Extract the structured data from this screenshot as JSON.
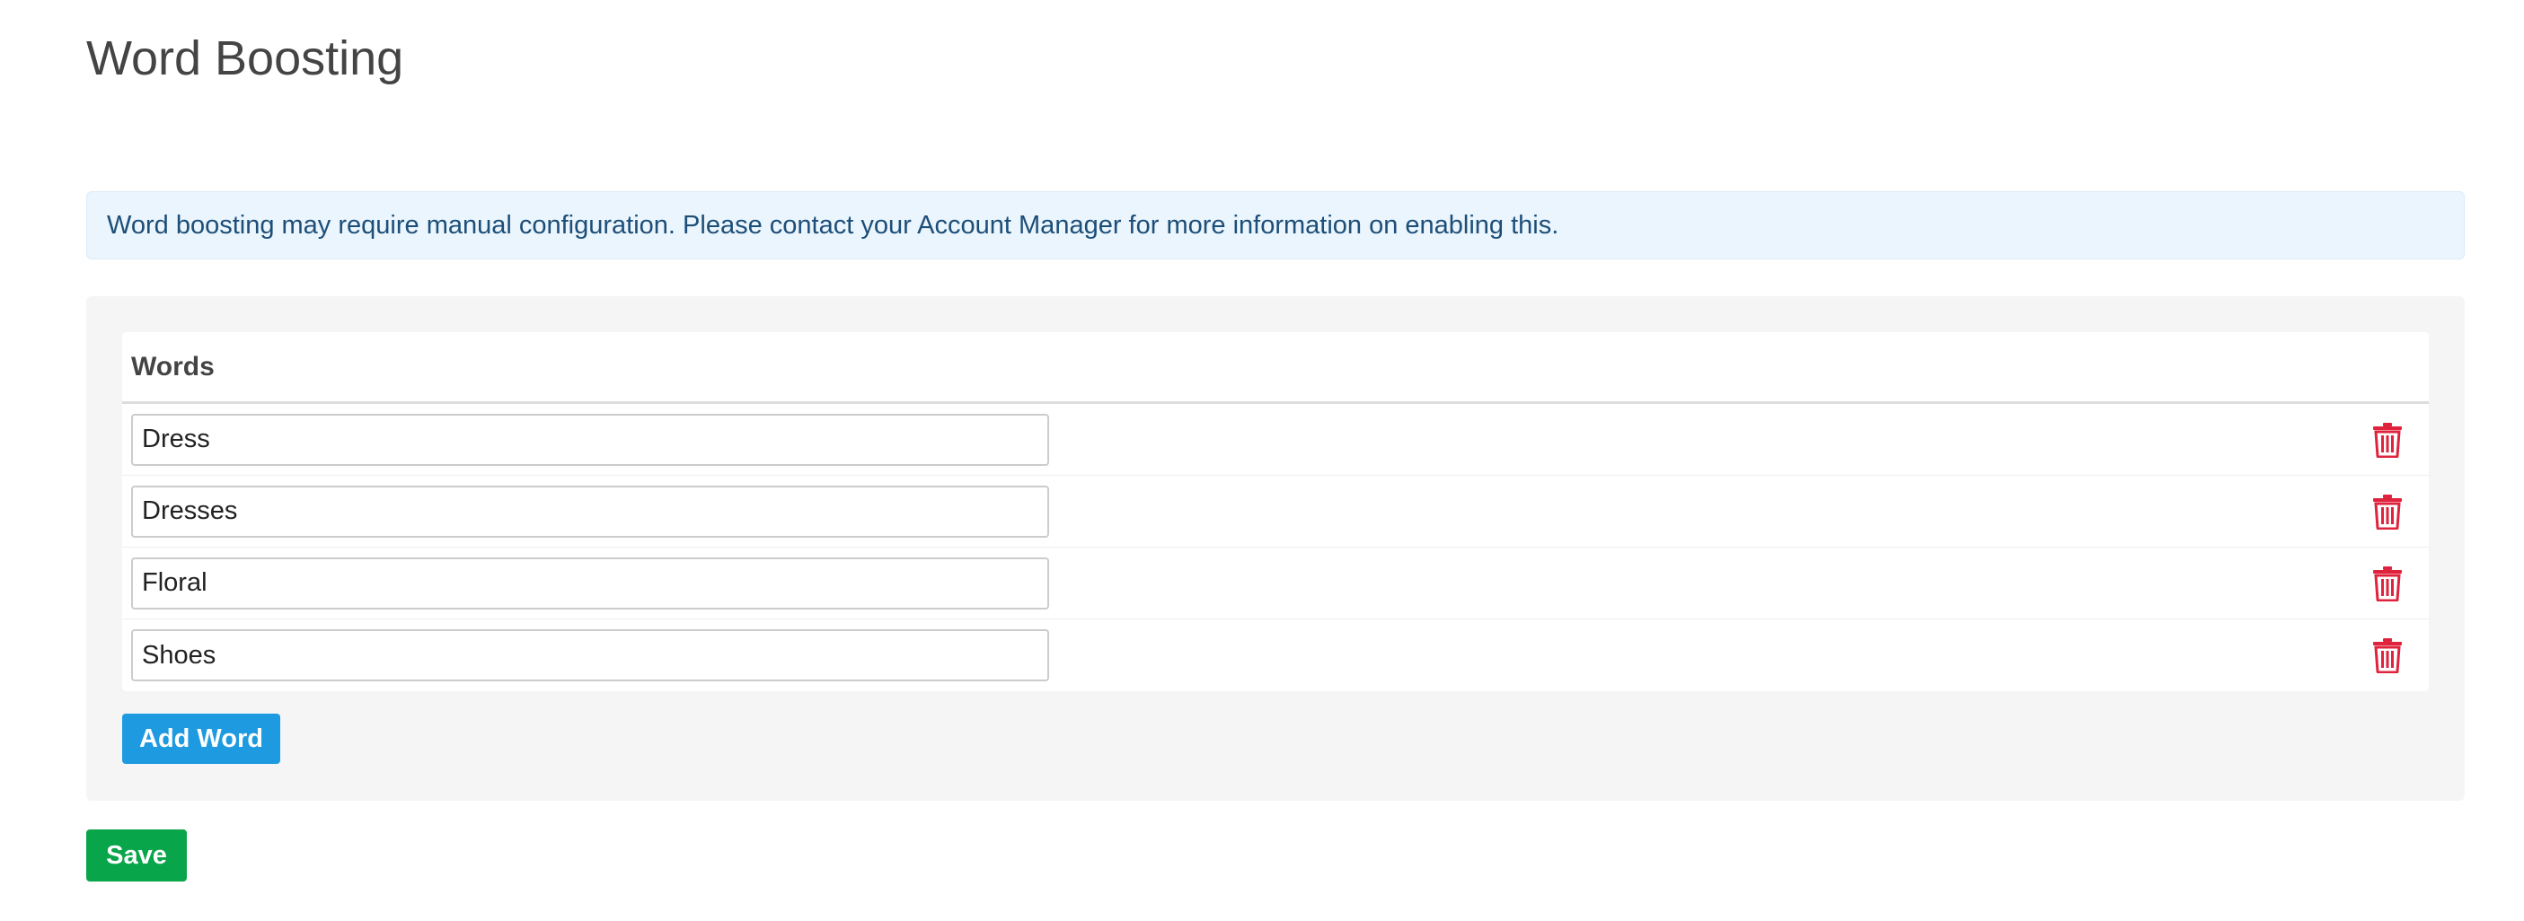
{
  "page": {
    "title": "Word Boosting"
  },
  "alert": {
    "message": "Word boosting may require manual configuration. Please contact your Account Manager for more information on enabling this."
  },
  "words_table": {
    "header": "Words",
    "rows": [
      {
        "value": "Dress"
      },
      {
        "value": "Dresses"
      },
      {
        "value": "Floral"
      },
      {
        "value": "Shoes"
      }
    ],
    "delete_icon": "trash-icon"
  },
  "buttons": {
    "add_word_label": "Add Word",
    "save_label": "Save"
  },
  "colors": {
    "alert_background": "#eaf5fd",
    "alert_text": "#1d4e78",
    "add_button": "#1e9ae0",
    "save_button": "#09a54a",
    "delete_icon": "#e0233d"
  }
}
